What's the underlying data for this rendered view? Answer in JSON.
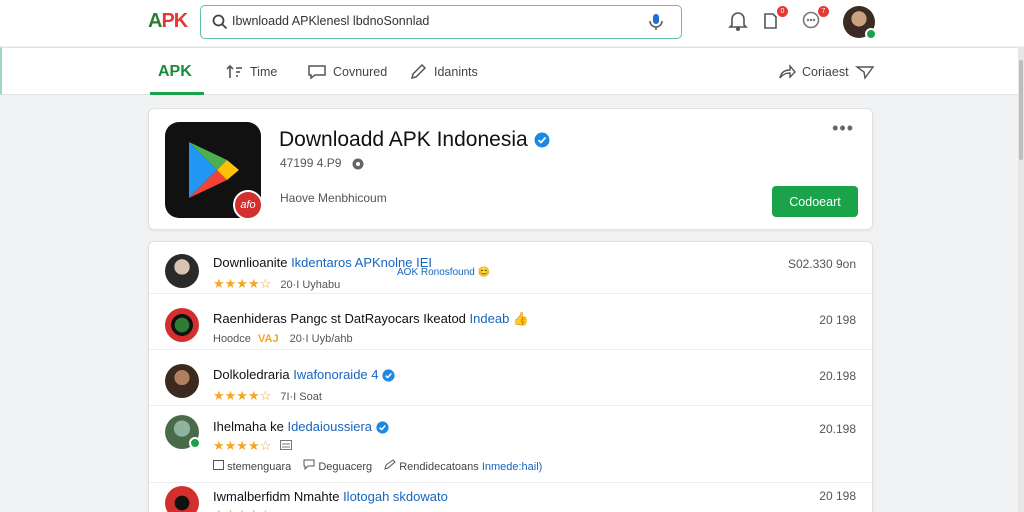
{
  "header": {
    "logo_text": "APK",
    "search_value": "Ibwnloadd APKlenesl lbdnoSonnlad",
    "notification_badge": "0",
    "chat_badge": "7"
  },
  "nav": {
    "tabs": [
      {
        "label": "APK",
        "icon": "none"
      },
      {
        "label": "Time",
        "icon": "sort-icon"
      },
      {
        "label": "Covnured",
        "icon": "comment-icon"
      },
      {
        "label": "Idanints",
        "icon": "pen-icon"
      }
    ],
    "contact_label": "Coriaest"
  },
  "profile": {
    "title": "Downloadd APK Indonesia",
    "stats": "47199 4.P9",
    "link_text": "Haove Menbhicoum",
    "contact_button": "Codoeart",
    "more": "•••",
    "icon_badge_text": "afo"
  },
  "posts": [
    {
      "name": "Downlioanite",
      "highlight": "Ikdentaros APKnolne IEI",
      "note": "AOK Ronosfound 😊",
      "rating_text": "20·I Uyhabu",
      "stars": "★★★★☆",
      "count": "S02.330 9on"
    },
    {
      "name": "Raenhideras Pangc st DatRayocars Ikeatod",
      "highlight": "Indeab 👍",
      "rating_text": "20·I Uyb/ahb",
      "prefix": "Hoodce",
      "tag": "VAJ",
      "count": "20 198"
    },
    {
      "name": "Dolkoledraria",
      "highlight": "Iwafonoraide 4",
      "rating_text": "7I·I Soat",
      "stars": "★★★★☆",
      "count": "20.198"
    },
    {
      "name": "Ihelmaha ke",
      "highlight": "Idedaioussiera",
      "stars": "★★★★☆",
      "count": "20.198",
      "actions": [
        "stemenguara",
        "Deguacerg",
        "Rendidecatoans"
      ],
      "actions_highlight": "Inmede:hail)"
    },
    {
      "name": "Iwmalberfidm Nmahte",
      "highlight": "Ilotogah skdowato",
      "stars": "★★★★☆",
      "count": "20 198"
    }
  ],
  "colors": {
    "accent_green": "#1aa34a",
    "link_blue": "#1565c0",
    "star": "#f5a623",
    "badge_red": "#e53935"
  }
}
